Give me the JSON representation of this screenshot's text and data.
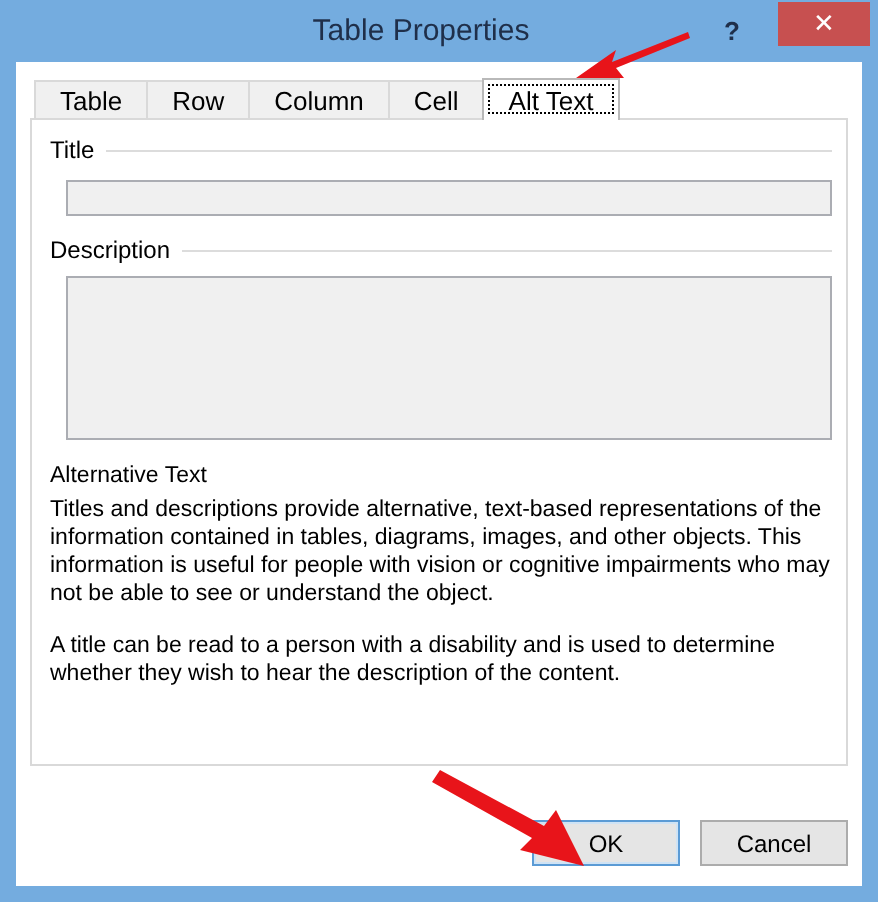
{
  "window": {
    "title": "Table Properties",
    "help_button": "?",
    "close_button": "✕"
  },
  "tabs": [
    {
      "label": "Table",
      "selected": false
    },
    {
      "label": "Row",
      "selected": false
    },
    {
      "label": "Column",
      "selected": false
    },
    {
      "label": "Cell",
      "selected": false
    },
    {
      "label": "Alt Text",
      "selected": true
    }
  ],
  "title_field": {
    "label": "Title"
  },
  "description_field": {
    "label": "Description"
  },
  "help": {
    "heading": "Alternative Text",
    "paragraphs": [
      "Titles and descriptions provide alternative, text-based representations of the information contained in tables, diagrams, images, and other objects. This information is useful for people with vision or cognitive impairments who may not be able to see or understand the object.",
      "A title can be read to a person with a disability and is used to determine whether they wish to hear the description of the content."
    ]
  },
  "buttons": [
    {
      "label": "OK",
      "default": true
    },
    {
      "label": "Cancel",
      "default": false
    }
  ]
}
